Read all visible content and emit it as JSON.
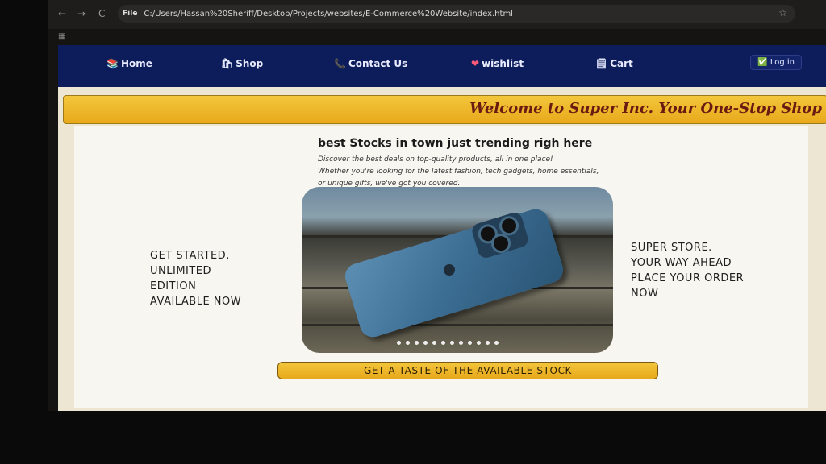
{
  "browser": {
    "back": "←",
    "forward": "→",
    "reload": "C",
    "chip": "File",
    "url": "C:/Users/Hassan%20Sheriff/Desktop/Projects/websites/E-Commerce%20Website/index.html",
    "star": "☆",
    "apps": "▦"
  },
  "navbar": {
    "items": [
      {
        "icon": "📚",
        "label": "Home"
      },
      {
        "icon": "🛍",
        "label": "Shop"
      },
      {
        "icon": "📞",
        "label": "Contact Us"
      },
      {
        "icon": "❤",
        "label": "wishlist"
      },
      {
        "icon": "🗒",
        "label": "Cart"
      }
    ],
    "login": {
      "icon": "✅",
      "label": "Log in"
    }
  },
  "banner": {
    "text": "Welcome to Super Inc. Your One-Stop Shop"
  },
  "hero": {
    "title": "best Stocks in town just trending righ here",
    "desc_line1": "Discover the best deals on top-quality products, all in one place!",
    "desc_line2": "Whether you're looking for the latest fashion, tech gadgets, home essentials,",
    "desc_line3": "or unique gifts, we've got you covered."
  },
  "left_text": [
    "GET STARTED.",
    "UNLIMITED",
    "EDITION",
    "AVAILABLE NOW"
  ],
  "right_text": [
    "SUPER STORE.",
    "YOUR WAY AHEAD",
    "PLACE YOUR ORDER",
    "NOW"
  ],
  "cta": {
    "label": "GET A TASTE OF THE AVAILABLE STOCK"
  },
  "colors": {
    "navbar": "#0d1d5c",
    "banner": "#f1c23a",
    "banner_text": "#6b1a12",
    "cta": "#efb52a"
  }
}
